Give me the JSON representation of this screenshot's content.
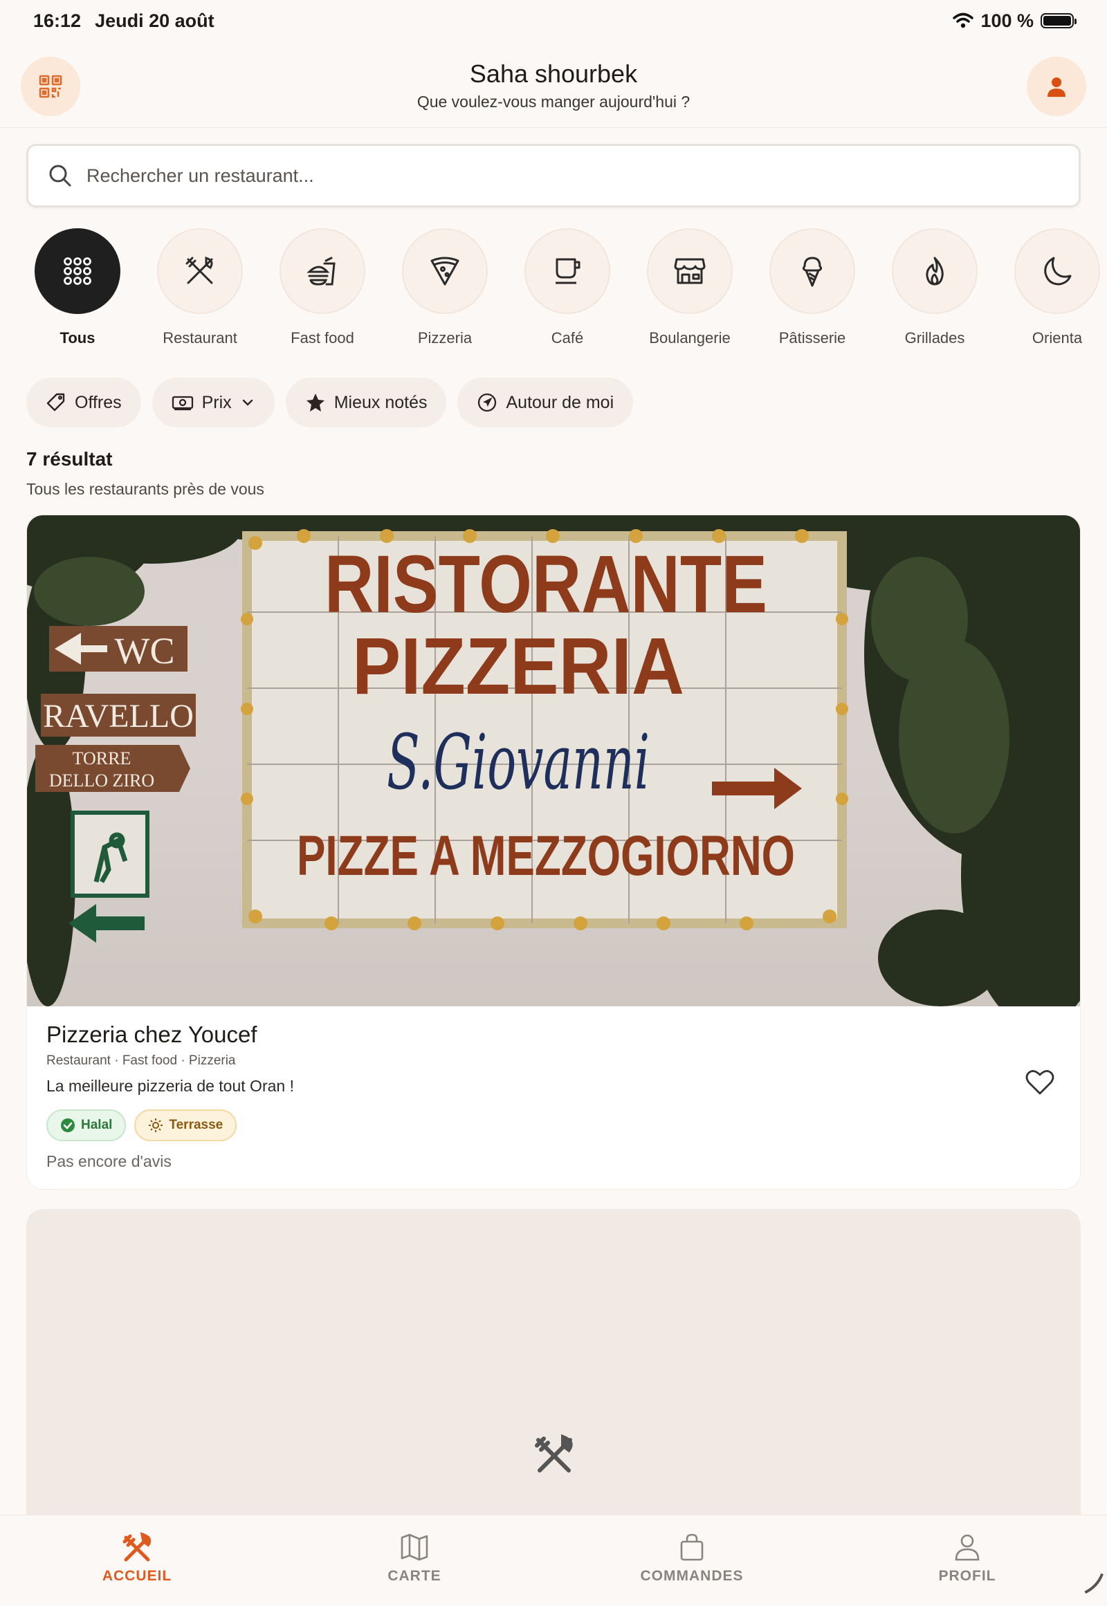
{
  "status_bar": {
    "time": "16:12",
    "date": "Jeudi 20 août",
    "battery": "100 %"
  },
  "header": {
    "title": "Saha shourbek",
    "subtitle": "Que voulez-vous manger aujourd'hui ?"
  },
  "search": {
    "placeholder": "Rechercher un restaurant..."
  },
  "categories": [
    {
      "label": "Tous",
      "icon": "grid-icon",
      "active": true
    },
    {
      "label": "Restaurant",
      "icon": "utensils-icon"
    },
    {
      "label": "Fast food",
      "icon": "burger-drink-icon"
    },
    {
      "label": "Pizzeria",
      "icon": "pizza-icon"
    },
    {
      "label": "Café",
      "icon": "coffee-cup-icon"
    },
    {
      "label": "Boulangerie",
      "icon": "storefront-icon"
    },
    {
      "label": "Pâtisserie",
      "icon": "ice-cream-icon"
    },
    {
      "label": "Grillades",
      "icon": "flame-icon"
    },
    {
      "label": "Orienta",
      "icon": "crescent-moon-icon"
    }
  ],
  "filters": [
    {
      "label": "Offres",
      "icon": "tag-icon"
    },
    {
      "label": "Prix",
      "icon": "banknote-icon"
    },
    {
      "label": "Mieux notés",
      "icon": "star-icon"
    },
    {
      "label": "Autour de moi",
      "icon": "location-arrow-icon"
    }
  ],
  "results": {
    "count_label": "7 résultat",
    "subtitle": "Tous les restaurants près de vous"
  },
  "card": {
    "sign": {
      "line1": "RISTORANTE",
      "line2": "PIZZERIA",
      "line3": "S.Giovanni",
      "line4": "PIZZE A MEZZOGIORNO",
      "wc": "WC",
      "ravello": "RAVELLO",
      "torre1": "TORRE",
      "torre2": "DELLO ZIRO"
    },
    "name": "Pizzeria chez Youcef",
    "tags": "Restaurant · Fast food · Pizzeria",
    "description": "La meilleure pizzeria de tout Oran !",
    "badges": [
      "Halal",
      "Terrasse"
    ],
    "review": "Pas encore d'avis"
  },
  "bottom_nav": [
    {
      "label": "ACCUEIL",
      "icon": "utensils-icon",
      "active": true
    },
    {
      "label": "CARTE",
      "icon": "map-icon"
    },
    {
      "label": "COMMANDES",
      "icon": "shopping-bag-icon"
    },
    {
      "label": "PROFIL",
      "icon": "user-icon"
    }
  ],
  "colors": {
    "accent": "#e05a1e",
    "background": "#fcf8f5",
    "active_category": "#1f1f1f"
  }
}
